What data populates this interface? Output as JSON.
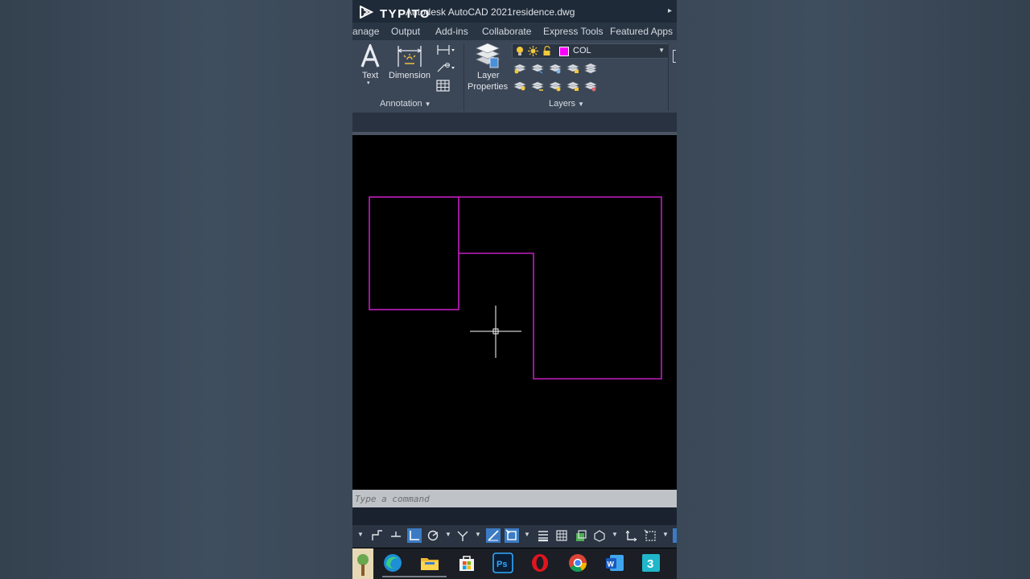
{
  "titlebar": {
    "overlay_text": "TYPITO",
    "app_name": "Autodesk AutoCAD 2021",
    "document": "residence.dwg",
    "more_glyph": "▸"
  },
  "tabs": [
    "anage",
    "Output",
    "Add-ins",
    "Collaborate",
    "Express Tools",
    "Featured Apps"
  ],
  "ribbon": {
    "annotation": {
      "text_label": "Text",
      "dimension_label": "Dimension",
      "panel_title": "Annotation"
    },
    "layers": {
      "properties_label_1": "Layer",
      "properties_label_2": "Properties",
      "current_layer": "COL",
      "current_layer_color": "#ff00ff",
      "panel_title": "Layers"
    }
  },
  "command_line": {
    "placeholder": "Type a command"
  },
  "colors": {
    "geometry": "#c21fc0",
    "crosshair": "#ffffff",
    "status_active": "#3c7bc4"
  },
  "taskbar": {
    "icons": [
      "windows-app-icon",
      "edge-icon",
      "file-explorer-icon",
      "store-icon",
      "photoshop-icon",
      "opera-icon",
      "chrome-icon",
      "word-icon",
      "autocad-3-icon"
    ]
  }
}
